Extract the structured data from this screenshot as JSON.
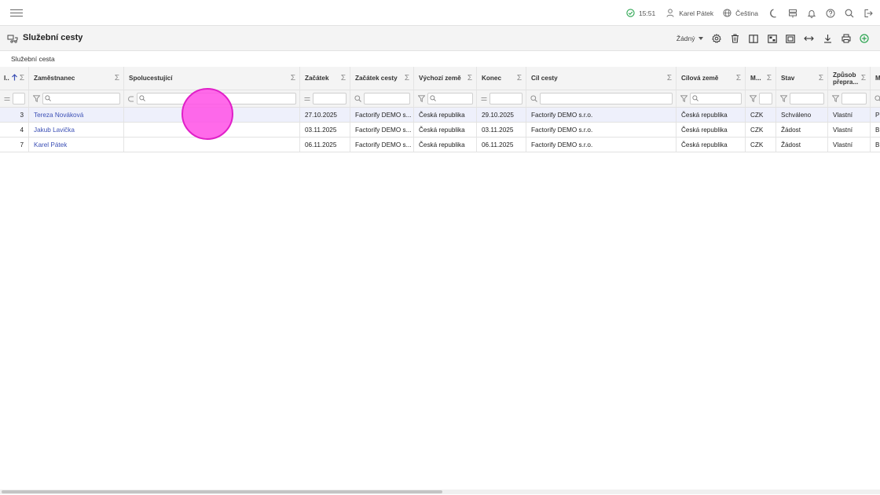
{
  "topbar": {
    "time": "15:51",
    "user": "Karel Pátek",
    "language": "Čeština"
  },
  "page": {
    "title": "Služební cesty",
    "preset": "Žádný",
    "section_label": "Služební cesta"
  },
  "columns": [
    {
      "key": "id",
      "label": "I..",
      "filter": "eq"
    },
    {
      "key": "employee",
      "label": "Zaměstnanec",
      "filter": "funnel"
    },
    {
      "key": "companions",
      "label": "Spolucestující",
      "filter": "subset"
    },
    {
      "key": "start",
      "label": "Začátek",
      "filter": "eq"
    },
    {
      "key": "trip_start",
      "label": "Začátek cesty",
      "filter": "search"
    },
    {
      "key": "origin_country",
      "label": "Výchozí země",
      "filter": "funnel"
    },
    {
      "key": "end",
      "label": "Konec",
      "filter": "eq"
    },
    {
      "key": "destination",
      "label": "Cíl cesty",
      "filter": "search"
    },
    {
      "key": "destination_country",
      "label": "Cílová země",
      "filter": "funnel"
    },
    {
      "key": "currency",
      "label": "M...",
      "filter": "funnel"
    },
    {
      "key": "status",
      "label": "Stav",
      "filter": "funnel"
    },
    {
      "key": "transport",
      "label": "Způsob přepra...",
      "filter": "funnel"
    },
    {
      "key": "extra",
      "label": "M",
      "filter": "search"
    }
  ],
  "rows": [
    {
      "id": "3",
      "employee": "Tereza Nováková",
      "companions": "",
      "start": "27.10.2025",
      "trip_start": "Factorify DEMO s...",
      "origin_country": "Česká republika",
      "end": "29.10.2025",
      "destination": "Factorify DEMO s.r.o.",
      "destination_country": "Česká republika",
      "currency": "CZK",
      "status": "Schváleno",
      "transport": "Vlastní",
      "extra": "Pr"
    },
    {
      "id": "4",
      "employee": "Jakub Lavička",
      "companions": "",
      "start": "03.11.2025",
      "trip_start": "Factorify DEMO s...",
      "origin_country": "Česká republika",
      "end": "03.11.2025",
      "destination": "Factorify DEMO s.r.o.",
      "destination_country": "Česká republika",
      "currency": "CZK",
      "status": "Žádost",
      "transport": "Vlastní",
      "extra": "Br"
    },
    {
      "id": "7",
      "employee": "Karel Pátek",
      "companions": "",
      "start": "06.11.2025",
      "trip_start": "Factorify DEMO s...",
      "origin_country": "Česká republika",
      "end": "06.11.2025",
      "destination": "Factorify DEMO s.r.o.",
      "destination_country": "Česká republika",
      "currency": "CZK",
      "status": "Žádost",
      "transport": "Vlastní",
      "extra": "Br"
    }
  ],
  "selected_row_index": 0,
  "colors": {
    "link": "#3b4fb5",
    "selected_row": "#eef0fb",
    "status_ok": "#2aa44f",
    "add_button": "#2aa44f",
    "sort_arrow": "#3b4fb5"
  }
}
